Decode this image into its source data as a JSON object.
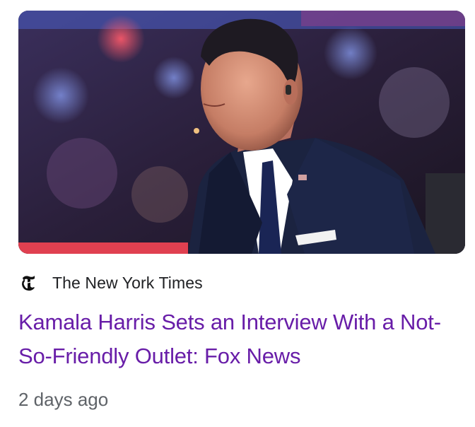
{
  "article": {
    "source": "The New York Times",
    "source_icon": "nyt-logo-icon",
    "headline": "Kamala Harris Sets an Interview With a Not-So-Friendly Outlet: Fox News",
    "age": "2 days ago",
    "thumbnail_icon": "news-anchor-photo"
  },
  "colors": {
    "headline_visited": "#681da8",
    "source_text": "#202124",
    "timestamp_text": "#5f6368"
  }
}
